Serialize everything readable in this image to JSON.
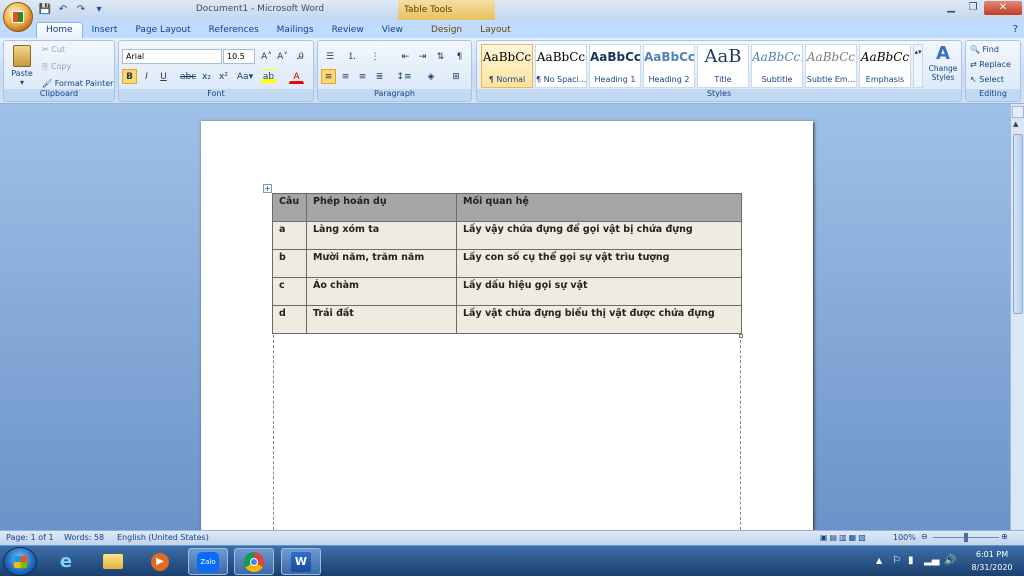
{
  "window": {
    "title": "Document1 - Microsoft Word",
    "context_tab_group": "Table Tools"
  },
  "tabs": [
    "Home",
    "Insert",
    "Page Layout",
    "References",
    "Mailings",
    "Review",
    "View",
    "Design",
    "Layout"
  ],
  "clipboard": {
    "paste": "Paste",
    "cut": "Cut",
    "copy": "Copy",
    "format_painter": "Format Painter",
    "label": "Clipboard"
  },
  "font": {
    "name": "Arial",
    "size": "10.5",
    "label": "Font"
  },
  "paragraph": {
    "label": "Paragraph"
  },
  "styles": {
    "items": [
      {
        "sample": "AaBbCc",
        "name": "¶ Normal"
      },
      {
        "sample": "AaBbCc",
        "name": "¶ No Spaci..."
      },
      {
        "sample": "AaBbCc",
        "name": "Heading 1"
      },
      {
        "sample": "AaBbCc",
        "name": "Heading 2"
      },
      {
        "sample": "AaB",
        "name": "Title"
      },
      {
        "sample": "AaBbCc.",
        "name": "Subtitle"
      },
      {
        "sample": "AaBbCc",
        "name": "Subtle Em..."
      },
      {
        "sample": "AaBbCc",
        "name": "Emphasis"
      }
    ],
    "change_styles": "Change Styles",
    "label": "Styles"
  },
  "editing": {
    "find": "Find",
    "replace": "Replace",
    "select": "Select",
    "label": "Editing"
  },
  "table": {
    "headers": [
      "Câu",
      "Phép hoán dụ",
      "Mối quan hệ"
    ],
    "rows": [
      [
        "a",
        "Làng xóm ta",
        "Lấy vậy chứa đựng để gọi vật bị chứa đựng"
      ],
      [
        "b",
        "Mười năm, trăm năm",
        "Lấy con số cụ thể gọi sự vật trìu tượng"
      ],
      [
        "c",
        "Áo chàm",
        "Lấy dấu hiệu gọi sự vật"
      ],
      [
        "d",
        "Trái đất",
        "Lấy vật chứa đựng biểu thị vật được chứa đựng"
      ]
    ]
  },
  "status": {
    "page": "Page: 1 of 1",
    "words": "Words: 58",
    "language": "English (United States)",
    "zoom": "100%"
  },
  "tray": {
    "time": "6:01 PM",
    "date": "8/31/2020"
  },
  "taskbar": {
    "zalo": "Zalo"
  }
}
